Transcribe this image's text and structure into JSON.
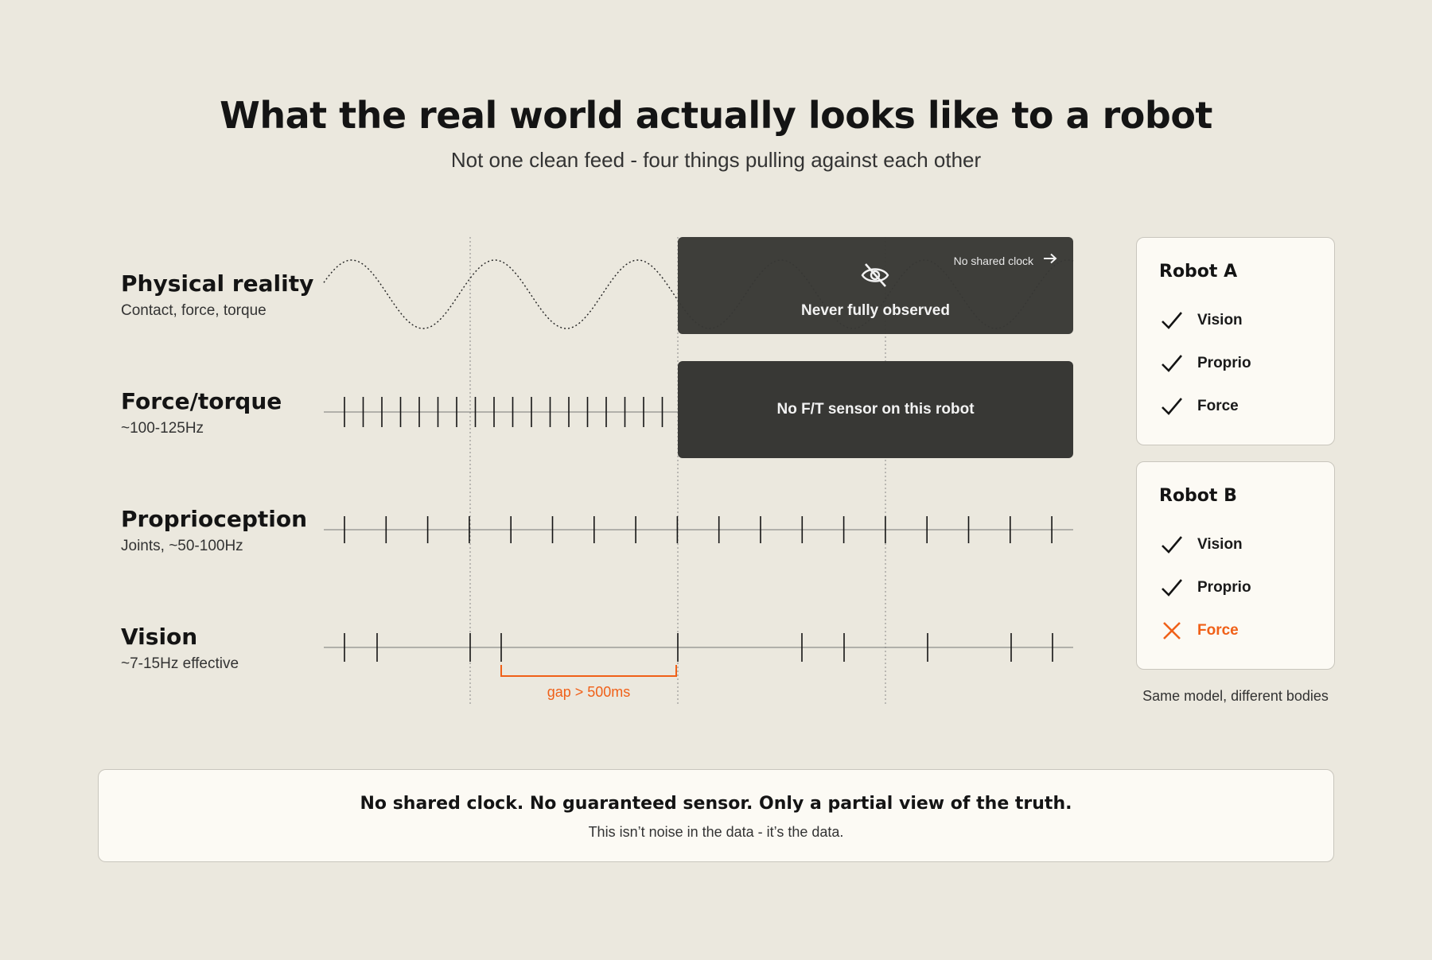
{
  "header": {
    "title": "What the real world actually looks like to a robot",
    "subtitle": "Not one clean feed - four things pulling against each other"
  },
  "rows": [
    {
      "name": "Physical reality",
      "desc": "Contact, force, torque"
    },
    {
      "name": "Force/torque",
      "desc": "~100-125Hz"
    },
    {
      "name": "Proprioception",
      "desc": "Joints, ~50-100Hz"
    },
    {
      "name": "Vision",
      "desc": "~7-15Hz effective"
    }
  ],
  "overlays": {
    "physical_text": "Never fully observed",
    "no_clock_text": "No shared clock",
    "force_text": "No F/T sensor on this robot"
  },
  "annotations": {
    "gap_label": "gap > 500ms"
  },
  "robots": [
    {
      "title": "Robot A",
      "items": [
        {
          "label": "Vision",
          "ok": true
        },
        {
          "label": "Proprio",
          "ok": true
        },
        {
          "label": "Force",
          "ok": true
        }
      ]
    },
    {
      "title": "Robot B",
      "items": [
        {
          "label": "Vision",
          "ok": true
        },
        {
          "label": "Proprio",
          "ok": true
        },
        {
          "label": "Force",
          "ok": false
        }
      ]
    }
  ],
  "robots_caption": "Same model, different bodies",
  "footer": {
    "headline": "No shared clock. No guaranteed sensor. Only a partial view of the truth.",
    "sub": "This isn’t noise in the data - it’s the data."
  },
  "colors": {
    "background": "#ebe8de",
    "dark_box": "#383835",
    "accent_orange": "#f06018",
    "card": "#fcfaf4"
  },
  "icons": {
    "physical_overlay": "eye-off-icon",
    "no_clock": "arrow-right-icon",
    "available": "check-icon",
    "missing": "x-icon"
  }
}
